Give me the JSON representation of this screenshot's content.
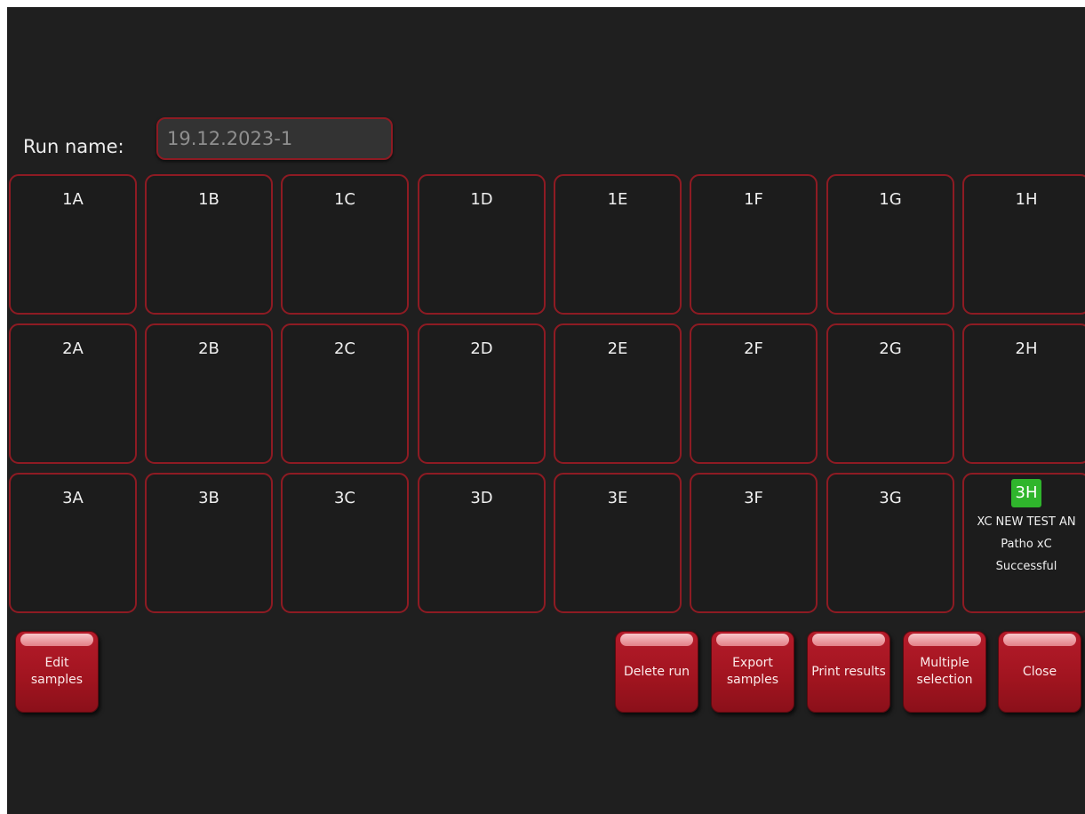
{
  "run": {
    "label": "Run name:",
    "value": "19.12.2023-1"
  },
  "wells": {
    "row1": [
      "1A",
      "1B",
      "1C",
      "1D",
      "1E",
      "1F",
      "1G",
      "1H"
    ],
    "row2": [
      "2A",
      "2B",
      "2C",
      "2D",
      "2E",
      "2F",
      "2G",
      "2H"
    ],
    "row3": [
      "3A",
      "3B",
      "3C",
      "3D",
      "3E",
      "3F",
      "3G"
    ]
  },
  "active_well": {
    "label": "3H",
    "sample_name": "XC NEW TEST AN",
    "assay": "Patho xC",
    "status": "Successful",
    "badge_color": "#2fb52c"
  },
  "buttons": {
    "edit_samples": "Edit samples",
    "delete_run": "Delete run",
    "export_samples": "Export samples",
    "print_results": "Print results",
    "multiple_selection": "Multiple selection",
    "close": "Close"
  },
  "colors": {
    "background": "#1f1f1f",
    "accent": "#8e1b23",
    "button": "#a0141f"
  }
}
